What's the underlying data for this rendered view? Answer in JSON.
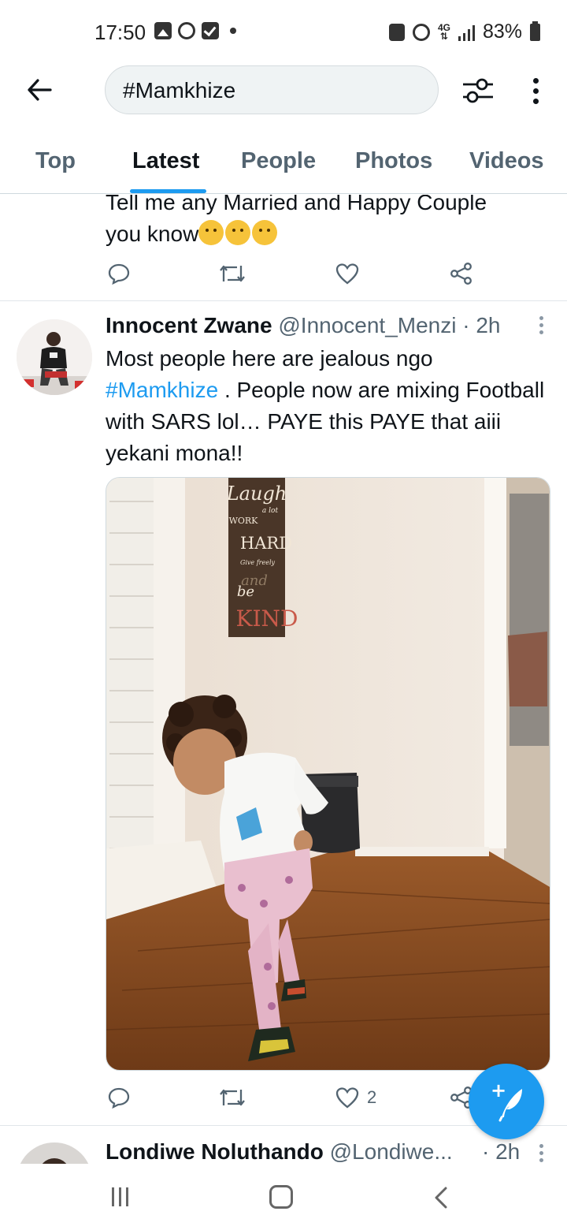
{
  "status_bar": {
    "time": "17:50",
    "network": "4G",
    "battery": "83%"
  },
  "header": {
    "back_icon": "arrow-left-icon",
    "search_query": "#Mamkhize",
    "filter_icon": "sliders-icon",
    "more_icon": "vertical-dots-icon"
  },
  "tabs": [
    {
      "label": "Top",
      "active": false
    },
    {
      "label": "Latest",
      "active": true
    },
    {
      "label": "People",
      "active": false
    },
    {
      "label": "Photos",
      "active": false
    },
    {
      "label": "Videos",
      "active": false
    }
  ],
  "accent_color": "#1d9bf0",
  "partial_tweet": {
    "text_line1": "Tell me any Married and Happy Couple",
    "text_line2": "you know"
  },
  "tweet": {
    "name": "Innocent Zwane",
    "handle": "@Innocent_Menzi",
    "time": "· 2h",
    "text_part1": "Most people here are jealous ngo",
    "hashtag": "#Mamkhize",
    "text_part2": " . People now are mixing Football with SARS lol… PAYE this PAYE that aiii yekani mona!!",
    "sign_lines": [
      "Laugh",
      "a lot",
      "WORK",
      "HARD",
      "Give freely",
      "and",
      "be",
      "KIND"
    ],
    "likes": "2"
  },
  "next_tweet": {
    "name": "Londiwe Noluthando",
    "handle": "@Londiwe...",
    "time": "· 2h"
  },
  "fab": {
    "icon": "compose-feather-icon",
    "plus": "+"
  }
}
